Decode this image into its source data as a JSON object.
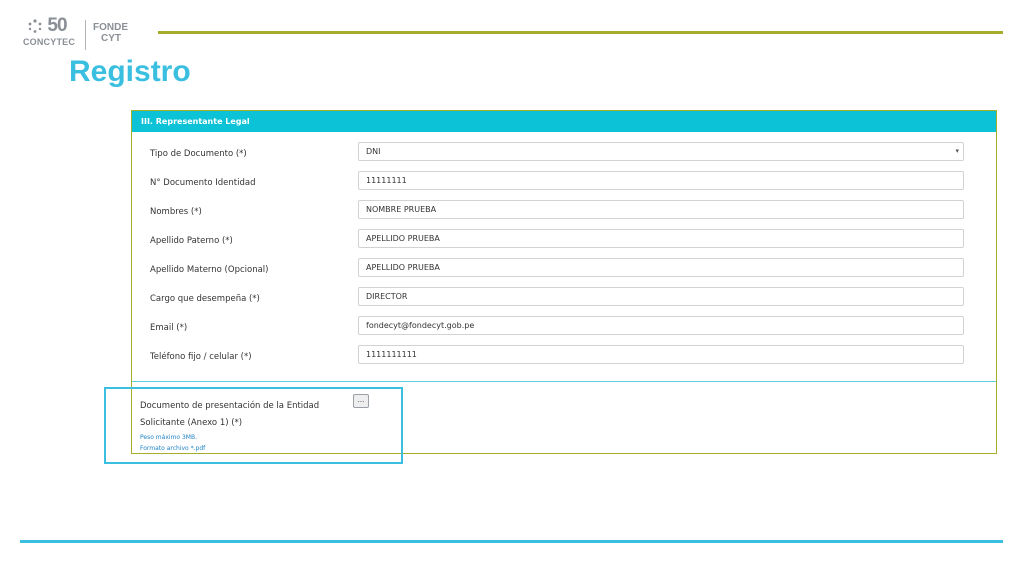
{
  "logo": {
    "number": "50",
    "concytec": "CONCYTEC",
    "fonde": "FONDE",
    "cyt": "CYT"
  },
  "page": {
    "title": "Registro"
  },
  "section": {
    "heading": "III. Representante Legal"
  },
  "form": {
    "fields": [
      {
        "label": "Tipo de Documento (*)",
        "value": "DNI",
        "type": "select"
      },
      {
        "label": "N° Documento Identidad",
        "value": "11111111",
        "type": "text"
      },
      {
        "label": "Nombres (*)",
        "value": "NOMBRE PRUEBA",
        "type": "text"
      },
      {
        "label": "Apellido Paterno (*)",
        "value": "APELLIDO PRUEBA",
        "type": "text"
      },
      {
        "label": "Apellido Materno (Opcional)",
        "value": "APELLIDO PRUEBA",
        "type": "text"
      },
      {
        "label": "Cargo que desempeña (*)",
        "value": "DIRECTOR",
        "type": "text"
      },
      {
        "label": "Email (*)",
        "value": "fondecyt@fondecyt.gob.pe",
        "type": "text"
      },
      {
        "label": "Teléfono fijo / celular (*)",
        "value": "1111111111",
        "type": "text"
      }
    ],
    "document": {
      "label_line1": "Documento de presentación de la Entidad",
      "label_line2": "Solicitante (Anexo 1) (*)",
      "hint_size": "Peso máximo 3MB.",
      "hint_format": "Formato archivo *.pdf",
      "browse_label": "..."
    }
  },
  "colors": {
    "accent_cyan": "#3bbfe0",
    "header_cyan": "#0cc2d6",
    "olive": "#a5ad2a"
  }
}
